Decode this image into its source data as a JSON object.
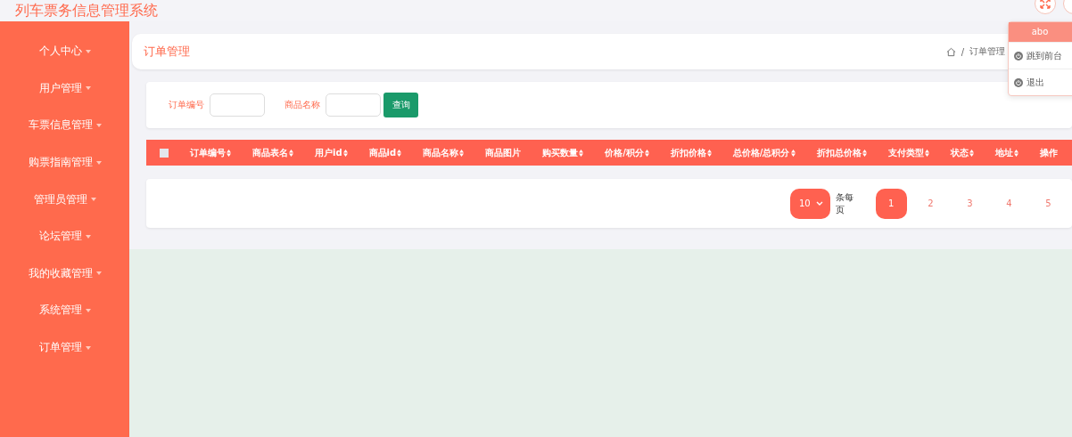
{
  "app_title": "列车票务信息管理系统",
  "sidebar": {
    "items": [
      {
        "label": "个人中心"
      },
      {
        "label": "用户管理"
      },
      {
        "label": "车票信息管理"
      },
      {
        "label": "购票指南管理"
      },
      {
        "label": "管理员管理"
      },
      {
        "label": "论坛管理"
      },
      {
        "label": "我的收藏管理"
      },
      {
        "label": "系统管理"
      },
      {
        "label": "订单管理"
      }
    ]
  },
  "page_title": "订单管理",
  "breadcrumb": [
    "订单管理"
  ],
  "breadcrumb_separator": "/",
  "search": {
    "fields": [
      {
        "label": "订单编号"
      },
      {
        "label": "商品名称"
      }
    ],
    "button": "查询"
  },
  "table": {
    "select_all": {
      "checked": false
    },
    "columns": [
      {
        "label": "订单编号",
        "sortable": true
      },
      {
        "label": "商品表名",
        "sortable": true
      },
      {
        "label": "用户id",
        "sortable": true
      },
      {
        "label": "商品id",
        "sortable": true
      },
      {
        "label": "商品名称",
        "sortable": true
      },
      {
        "label": "商品图片",
        "sortable": false
      },
      {
        "label": "购买数量",
        "sortable": true
      },
      {
        "label": "价格/积分",
        "sortable": true
      },
      {
        "label": "折扣价格",
        "sortable": true
      },
      {
        "label": "总价格/总积分",
        "sortable": true
      },
      {
        "label": "折扣总价格",
        "sortable": true
      },
      {
        "label": "支付类型",
        "sortable": true
      },
      {
        "label": "状态",
        "sortable": true
      },
      {
        "label": "地址",
        "sortable": true
      },
      {
        "label": "操作",
        "sortable": false
      }
    ]
  },
  "pagination": {
    "page_size": "10",
    "page_size_label": "条每页",
    "pages": [
      {
        "label": "1",
        "selected": true
      },
      {
        "label": "2",
        "selected": false
      },
      {
        "label": "3",
        "selected": false
      },
      {
        "label": "4",
        "selected": false
      },
      {
        "label": "5",
        "selected": false
      }
    ]
  },
  "user_menu": {
    "user": "abo",
    "items": [
      {
        "label": "跳到前台"
      },
      {
        "label": "退出"
      }
    ]
  }
}
